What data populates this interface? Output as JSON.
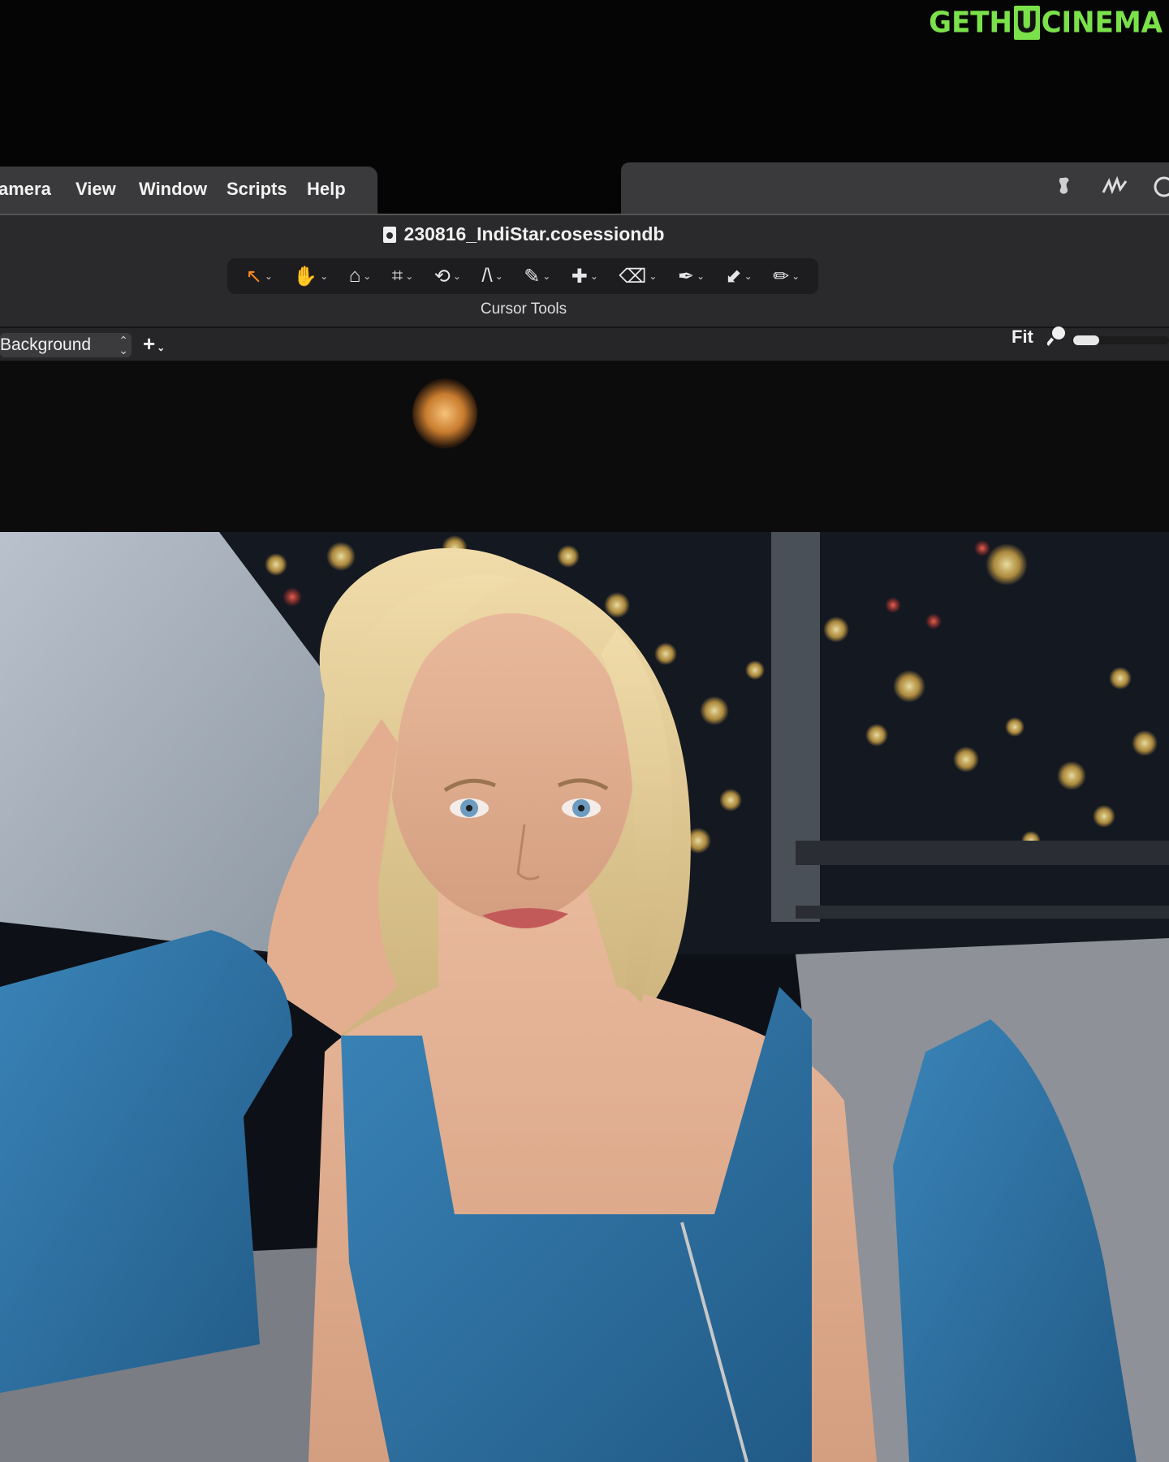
{
  "watermark": {
    "part1": "GETH",
    "part2": "U",
    "part3": "CINEMA"
  },
  "menubar": {
    "items": [
      "Camera",
      "View",
      "Window",
      "Scripts",
      "Help"
    ],
    "display_first": "amera"
  },
  "document": {
    "title": "230816_IndiStar.cosessiondb"
  },
  "toolbar": {
    "group_label": "Cursor Tools",
    "tools": [
      {
        "name": "select-tool",
        "glyph": "↖",
        "active": true
      },
      {
        "name": "pan-tool",
        "glyph": "✋"
      },
      {
        "name": "loupe-tool",
        "glyph": "⌂"
      },
      {
        "name": "crop-tool",
        "glyph": "⌗"
      },
      {
        "name": "rotate-tool",
        "glyph": "⟲"
      },
      {
        "name": "keystone-tool",
        "glyph": "/\\"
      },
      {
        "name": "draw-mask-tool",
        "glyph": "✎"
      },
      {
        "name": "heal-tool",
        "glyph": "✚"
      },
      {
        "name": "erase-mask-tool",
        "glyph": "⌫"
      },
      {
        "name": "picker-tool",
        "glyph": "✒"
      },
      {
        "name": "fill-mask-tool",
        "glyph": "⬋"
      },
      {
        "name": "annotate-tool",
        "glyph": "✏"
      }
    ]
  },
  "viewer": {
    "layer_select": "Background",
    "add_layer": "+",
    "zoom_label": "Fit"
  }
}
